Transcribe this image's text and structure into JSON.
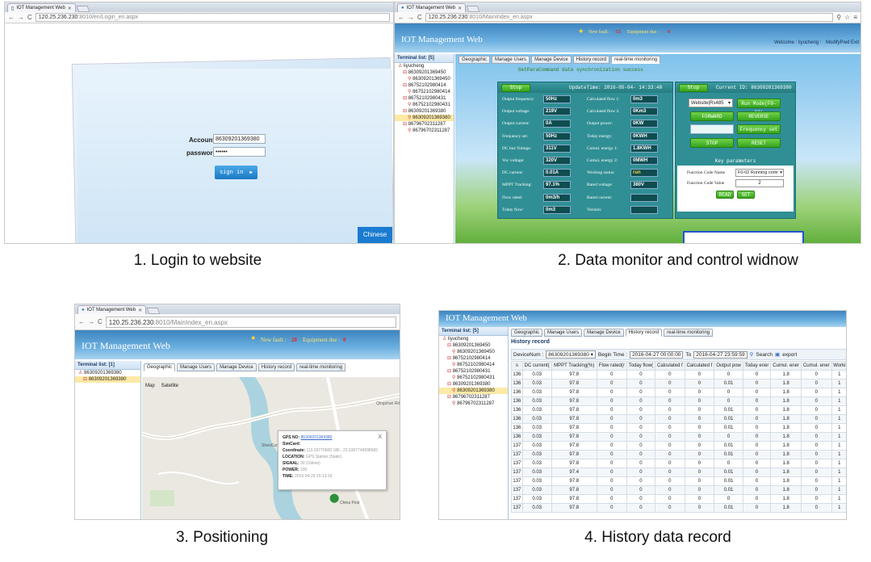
{
  "captions": [
    "1. Login to website",
    "2. Data monitor and control widnow",
    "3. Positioning",
    "4. History data record"
  ],
  "login": {
    "tab_title": "IOT Management Web",
    "url_host": "120.25.236.230",
    "url_path": ":8010/en/Login_en.aspx",
    "account_label": "Account:",
    "account_value": "86309201369380",
    "password_label": "password:",
    "password_value": "••••••",
    "signin_label": "sign in",
    "signin_arrow": "▶",
    "chinese_label": "Chinese"
  },
  "monitor": {
    "tab_title": "IOT Management Web",
    "url_host": "120.25.236.230",
    "url_path": ":8010/MainIndex_en.aspx",
    "app_title": "IOT Management Web",
    "new_fault_label": "New fault :",
    "new_fault_count": "51",
    "equipment_due_label": "Equipment due :",
    "equipment_due_count": "0",
    "welcome": "Welcome : liyucheng :",
    "modify_pwd": "ModifyPwd Exit",
    "tree_header": "Terminal list: [5]",
    "tree": [
      {
        "t": "liyucheng",
        "l": 1
      },
      {
        "t": "86309201369450",
        "l": 2
      },
      {
        "t": "86309201369450",
        "l": 3
      },
      {
        "t": "86752102980414",
        "l": 2
      },
      {
        "t": "86752102980414",
        "l": 3
      },
      {
        "t": "86752102980431",
        "l": 2
      },
      {
        "t": "86752102980431",
        "l": 3
      },
      {
        "t": "86309201369380",
        "l": 2
      },
      {
        "t": "86309201369380",
        "l": 3,
        "sel": true
      },
      {
        "t": "86796702311287",
        "l": 2
      },
      {
        "t": "86796702311287",
        "l": 3
      }
    ],
    "tabs": [
      "Geographic",
      "Manage Users",
      "Manage Device",
      "History record",
      "real-time monitoring"
    ],
    "sync_msg": "GetParaCommand data synchronization success",
    "stop_label": "Stop",
    "update_time": "UpdateTime: 2016-05-04- 14:33:40",
    "current_id": "Current ID: 86309201369380",
    "rows_left": [
      [
        "Output frequency:",
        "50Hz"
      ],
      [
        "Output voltage:",
        "219V"
      ],
      [
        "Output current:",
        "0A"
      ],
      [
        "Frequency set:",
        "50Hz"
      ],
      [
        "DC bus Voltage:",
        "311V"
      ],
      [
        "Voc voltage:",
        "320V"
      ],
      [
        "DC current:",
        "0.01A"
      ],
      [
        "MPPT Tracking:",
        "97.1%"
      ],
      [
        "Flow rated:",
        "0m3/h"
      ],
      [
        "Today flow:",
        "0m3"
      ]
    ],
    "rows_right": [
      [
        "Calculated flow 1:",
        "0m3"
      ],
      [
        "Calculated flow 2:",
        "0Km3"
      ],
      [
        "Output power:",
        "0KW"
      ],
      [
        "Today energy:",
        "0KWH"
      ],
      [
        "Cumul. energy 1:",
        "1.8KWH"
      ],
      [
        "Cumul. energy 2:",
        "0MWH"
      ],
      [
        "Working status:",
        "run"
      ],
      [
        "Rated voltage:",
        "380V"
      ],
      [
        "Rated current:",
        ""
      ],
      [
        "Version:",
        ""
      ]
    ],
    "ctl_select": "Website|Rs485",
    "run_mode": "Run Mode(F0-02)",
    "forward": "FORWARD",
    "reverse": "REVERSE",
    "freq_set": "Frequency set",
    "stop_btn": "STOP",
    "reset_btn": "RESET",
    "key_params": "Key parameters",
    "func_name_label": "Function Code Name",
    "func_name_value": "F0-02 Running comr",
    "func_value_label": "Function Code Value",
    "func_value": "2",
    "read": "READ",
    "set": "SET"
  },
  "positioning": {
    "tab_title": "IOT Management Web",
    "url_host": "120.25.236.230",
    "url_path": ":8010/MainIndex_en.aspx",
    "app_title": "IOT Management Web",
    "new_fault_label": "New fault :",
    "new_fault_count": "28",
    "equipment_due_label": "Equipment due :",
    "equipment_due_count": "0",
    "tree_header": "Terminal list: [1]",
    "tree": [
      {
        "t": "86309201369380",
        "l": 1
      },
      {
        "t": "86309201369380",
        "l": 2,
        "sel": true
      }
    ],
    "tabs": [
      "Geographic",
      "Manage Users",
      "Manage Device",
      "History record",
      "real-time monitoring"
    ],
    "map_btn": "Map",
    "satellite_btn": "Satellite",
    "popup": {
      "gps_label": "GPS NO:",
      "gps_value": "86309201369380",
      "sim_label": "SimCard:",
      "sim_value": "",
      "coord_label": "Coordinate:",
      "coord_value": "113.93770600 186 , 22.6367749998582",
      "loc_label": "LOCATION:",
      "loc_value": "GPS Station (Static)",
      "signal_label": "SIGNAL:",
      "signal_value": "30 (Online)",
      "power_label": "POWER:",
      "power_value": "100",
      "time_label": "TIME:",
      "time_value": "2016-04-29 15:13:19",
      "close": "X"
    },
    "map_labels": [
      "Qingshan Rd",
      "ShenCun",
      "China Post"
    ]
  },
  "history": {
    "app_title": "IOT Management Web",
    "tree_header": "Terminal list: [5]",
    "tree": [
      {
        "t": "liyucheng",
        "l": 1
      },
      {
        "t": "86309201369450",
        "l": 2
      },
      {
        "t": "86309201369450",
        "l": 3
      },
      {
        "t": "86752102980414",
        "l": 2
      },
      {
        "t": "86752102980414",
        "l": 3
      },
      {
        "t": "86752102980431",
        "l": 2
      },
      {
        "t": "86752102980431",
        "l": 3
      },
      {
        "t": "86309201369380",
        "l": 2
      },
      {
        "t": "86309201369380",
        "l": 3,
        "sel": true
      },
      {
        "t": "86796702311287",
        "l": 2
      },
      {
        "t": "86796702311287",
        "l": 3
      }
    ],
    "tabs": [
      "Geographic",
      "Manage Users",
      "Manage Device",
      "History record",
      "real-time monitoring"
    ],
    "section_title": "History record",
    "device_label": "DeviceNum :",
    "device_value": "86309201369380",
    "begin_label": "Begin Time :",
    "begin_value": "2016-04-27 00:00:00",
    "to_label": "To",
    "end_value": "2016-04-27 23:59:59",
    "search": "Search",
    "export": "export",
    "columns": [
      "s",
      "DC current(",
      "MPPT Tracking(%)",
      "Flow rated(r",
      "Today flow(",
      "Calculated f",
      "Calculated f",
      "Output pow",
      "Today ener",
      "Cumul. ener",
      "Cumul. ener",
      "Worki"
    ],
    "rows": [
      [
        "136",
        "0.03",
        "97.8",
        "0",
        "0",
        "0",
        "0",
        "0",
        "0",
        "1.8",
        "0",
        "1"
      ],
      [
        "136",
        "0.03",
        "97.8",
        "0",
        "0",
        "0",
        "0",
        "0.01",
        "0",
        "1.8",
        "0",
        "1"
      ],
      [
        "136",
        "0.03",
        "97.8",
        "0",
        "0",
        "0",
        "0",
        "0",
        "0",
        "1.8",
        "0",
        "1"
      ],
      [
        "136",
        "0.03",
        "97.8",
        "0",
        "0",
        "0",
        "0",
        "0",
        "0",
        "1.8",
        "0",
        "1"
      ],
      [
        "136",
        "0.03",
        "97.8",
        "0",
        "0",
        "0",
        "0",
        "0.01",
        "0",
        "1.8",
        "0",
        "1"
      ],
      [
        "136",
        "0.03",
        "97.8",
        "0",
        "0",
        "0",
        "0",
        "0.01",
        "0",
        "1.8",
        "0",
        "1"
      ],
      [
        "136",
        "0.03",
        "97.8",
        "0",
        "0",
        "0",
        "0",
        "0.01",
        "0",
        "1.8",
        "0",
        "1"
      ],
      [
        "136",
        "0.03",
        "97.8",
        "0",
        "0",
        "0",
        "0",
        "0",
        "0",
        "1.8",
        "0",
        "1"
      ],
      [
        "137",
        "0.03",
        "97.8",
        "0",
        "0",
        "0",
        "0",
        "0.01",
        "0",
        "1.8",
        "0",
        "1"
      ],
      [
        "137",
        "0.03",
        "97.8",
        "0",
        "0",
        "0",
        "0",
        "0.01",
        "0",
        "1.8",
        "0",
        "1"
      ],
      [
        "137",
        "0.03",
        "97.8",
        "0",
        "0",
        "0",
        "0",
        "0",
        "0",
        "1.8",
        "0",
        "1"
      ],
      [
        "137",
        "0.03",
        "97.4",
        "0",
        "0",
        "0",
        "0",
        "0.01",
        "0",
        "1.8",
        "0",
        "1"
      ],
      [
        "137",
        "0.03",
        "97.8",
        "0",
        "0",
        "0",
        "0",
        "0.01",
        "0",
        "1.8",
        "0",
        "1"
      ],
      [
        "137",
        "0.03",
        "97.8",
        "0",
        "0",
        "0",
        "0",
        "0.01",
        "0",
        "1.8",
        "0",
        "1"
      ],
      [
        "137",
        "0.03",
        "97.8",
        "0",
        "0",
        "0",
        "0",
        "0",
        "0",
        "1.8",
        "0",
        "1"
      ],
      [
        "137",
        "0.03",
        "97.8",
        "0",
        "0",
        "0",
        "0",
        "0.01",
        "0",
        "1.8",
        "0",
        "1"
      ]
    ]
  }
}
